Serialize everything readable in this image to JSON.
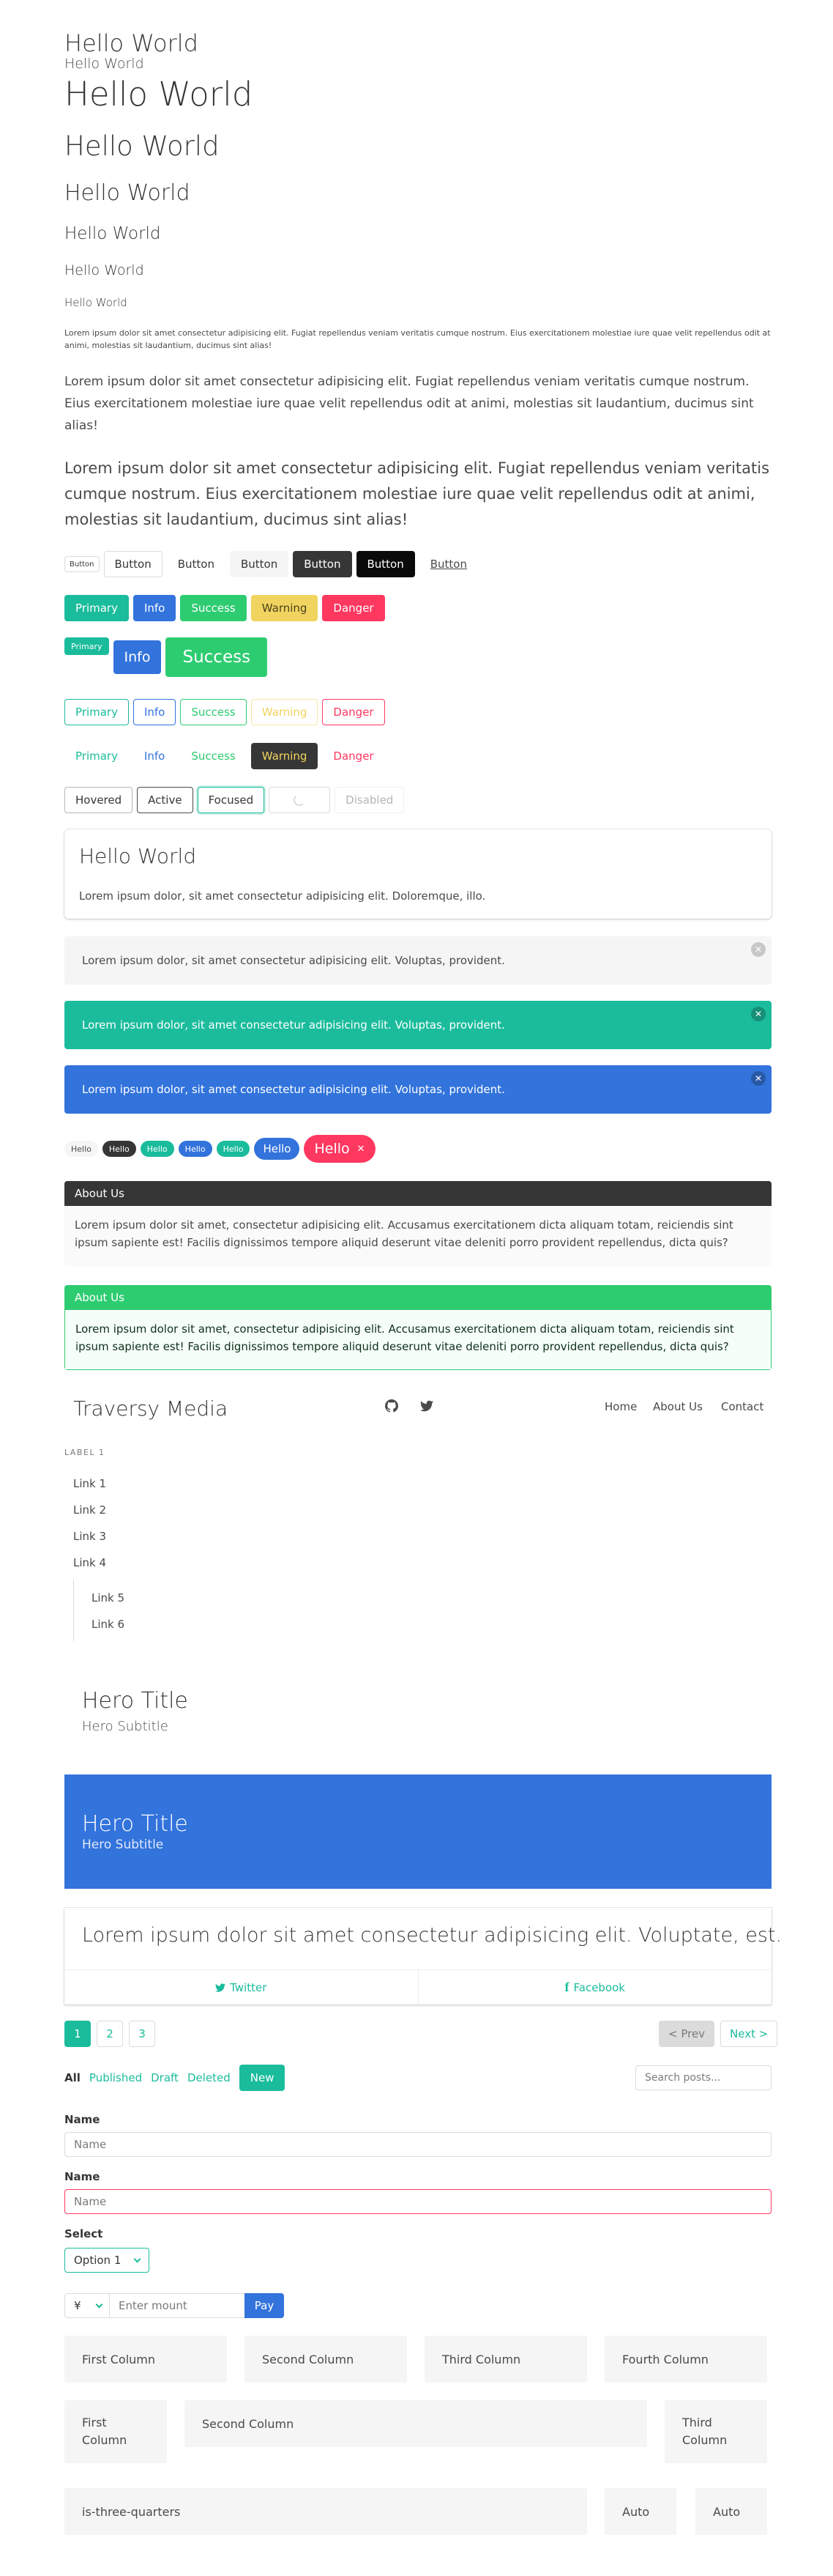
{
  "typography": {
    "h_title": "Hello World",
    "h_subtitle": "Hello World",
    "sizes": [
      "Hello World",
      "Hello World",
      "Hello World",
      "Hello World",
      "Hello World",
      "Hello World"
    ],
    "small_para": "Lorem ipsum dolor sit amet consectetur adipisicing elit. Fugiat repellendus veniam veritatis cumque nostrum. Eius exercitationem molestiae iure quae velit repellendus odit at animi, molestias sit laudantium, ducimus sint alias!",
    "medium_para": "Lorem ipsum dolor sit amet consectetur adipisicing elit. Fugiat repellendus veniam veritatis cumque nostrum. Eius exercitationem molestiae iure quae velit repellendus odit at animi, molestias sit laudantium, ducimus sint alias!",
    "large_para": "Lorem ipsum dolor sit amet consectetur adipisicing elit. Fugiat repellendus veniam veritatis cumque nostrum. Eius exercitationem molestiae iure quae velit repellendus odit at animi, molestias sit laudantium, ducimus sint alias!"
  },
  "buttons": {
    "row1": [
      "Button",
      "Button",
      "Button",
      "Button",
      "Button",
      "Button",
      "Button"
    ],
    "colors": [
      "Primary",
      "Info",
      "Success",
      "Warning",
      "Danger"
    ],
    "sizes": [
      "Primary",
      "Info",
      "Success"
    ],
    "outlined": [
      "Primary",
      "Info",
      "Success",
      "Warning",
      "Danger"
    ],
    "inverted": [
      "Primary",
      "Info",
      "Success",
      "Warning",
      "Danger"
    ],
    "states": [
      "Hovered",
      "Active",
      "Focused",
      "",
      "Disabled"
    ]
  },
  "box": {
    "title": "Hello World",
    "text": "Lorem ipsum dolor, sit amet consectetur adipisicing elit. Doloremque, illo."
  },
  "notifications": [
    "Lorem ipsum dolor, sit amet consectetur adipisicing elit. Voluptas, provident.",
    "Lorem ipsum dolor, sit amet consectetur adipisicing elit. Voluptas, provident.",
    "Lorem ipsum dolor, sit amet consectetur adipisicing elit. Voluptas, provident."
  ],
  "tags": [
    "Hello",
    "Hello",
    "Hello",
    "Hello",
    "Hello",
    "Hello",
    "Hello"
  ],
  "messages": [
    {
      "header": "About Us",
      "body": "Lorem ipsum dolor sit amet, consectetur adipisicing elit. Accusamus exercitationem dicta aliquam totam, reiciendis sint ipsum sapiente est! Facilis dignissimos tempore aliquid deserunt vitae deleniti porro provident repellendus, dicta quis?"
    },
    {
      "header": "About Us",
      "body": "Lorem ipsum dolor sit amet, consectetur adipisicing elit. Accusamus exercitationem dicta aliquam totam, reiciendis sint ipsum sapiente est! Facilis dignissimos tempore aliquid deserunt vitae deleniti porro provident repellendus, dicta quis?"
    }
  ],
  "navbar": {
    "brand": "Traversy Media",
    "links": [
      "Home",
      "About Us",
      "Contact"
    ]
  },
  "menu": {
    "label": "LABEL 1",
    "links": [
      "Link 1",
      "Link 2",
      "Link 3",
      "Link 4"
    ],
    "sublinks": [
      "Link 5",
      "Link 6"
    ]
  },
  "hero1": {
    "title": "Hero Title",
    "subtitle": "Hero Subtitle"
  },
  "hero2": {
    "title": "Hero Title",
    "subtitle": "Hero Subtitle"
  },
  "card": {
    "content": "Lorem ipsum dolor sit amet consectetur adipisicing elit. Voluptate, est.",
    "footer": [
      "Twitter",
      "Facebook"
    ]
  },
  "pagination": {
    "pages": [
      "1",
      "2",
      "3"
    ],
    "prev": "< Prev",
    "next": "Next >"
  },
  "level": {
    "filters": [
      "All",
      "Published",
      "Draft",
      "Deleted"
    ],
    "new": "New",
    "search_placeholder": "Search posts..."
  },
  "form": {
    "name_label": "Name",
    "name_placeholder": "Name",
    "name2_label": "Name",
    "name2_placeholder": "Name",
    "select_label": "Select",
    "select_value": "Option 1",
    "currency": "¥",
    "amount_placeholder": "Enter mount",
    "pay": "Pay"
  },
  "columns": {
    "row1": [
      "First Column",
      "Second Column",
      "Third Column",
      "Fourth Column"
    ],
    "row2": [
      "First Column",
      "Second Column",
      "Third Column"
    ],
    "row3": [
      "is-three-quarters",
      "Auto",
      "Auto"
    ]
  }
}
